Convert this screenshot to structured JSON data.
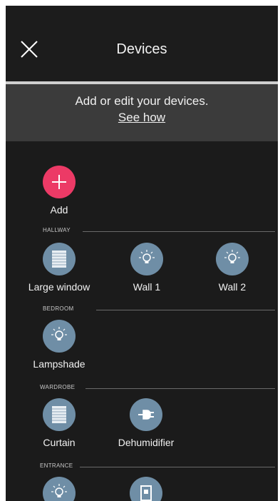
{
  "header": {
    "title": "Devices",
    "close_icon": "close-icon"
  },
  "banner": {
    "text": "Add or edit your devices.",
    "link": "See how"
  },
  "add": {
    "label": "Add",
    "icon": "plus-icon",
    "color": "#ec3a66"
  },
  "sections": [
    {
      "title": "HALLWAY",
      "devices": [
        {
          "label": "Large window",
          "icon": "window-shutter-icon"
        },
        {
          "label": "Wall 1",
          "icon": "light-bulb-icon"
        },
        {
          "label": "Wall 2",
          "icon": "light-bulb-icon"
        }
      ]
    },
    {
      "title": "BEDROOM",
      "devices": [
        {
          "label": "Lampshade",
          "icon": "light-bulb-icon"
        }
      ]
    },
    {
      "title": "WARDROBE",
      "devices": [
        {
          "label": "Curtain",
          "icon": "window-shutter-icon"
        },
        {
          "label": "Dehumidifier",
          "icon": "power-plug-icon"
        }
      ]
    },
    {
      "title": "ENTRANCE",
      "devices": [
        {
          "label": "",
          "icon": "light-bulb-icon"
        },
        {
          "label": "",
          "icon": "door-icon"
        }
      ]
    }
  ],
  "colors": {
    "background": "#1b1b1b",
    "banner": "#3b3b3b",
    "device_icon": "#6f8ea6",
    "add_button": "#ec3a66"
  }
}
